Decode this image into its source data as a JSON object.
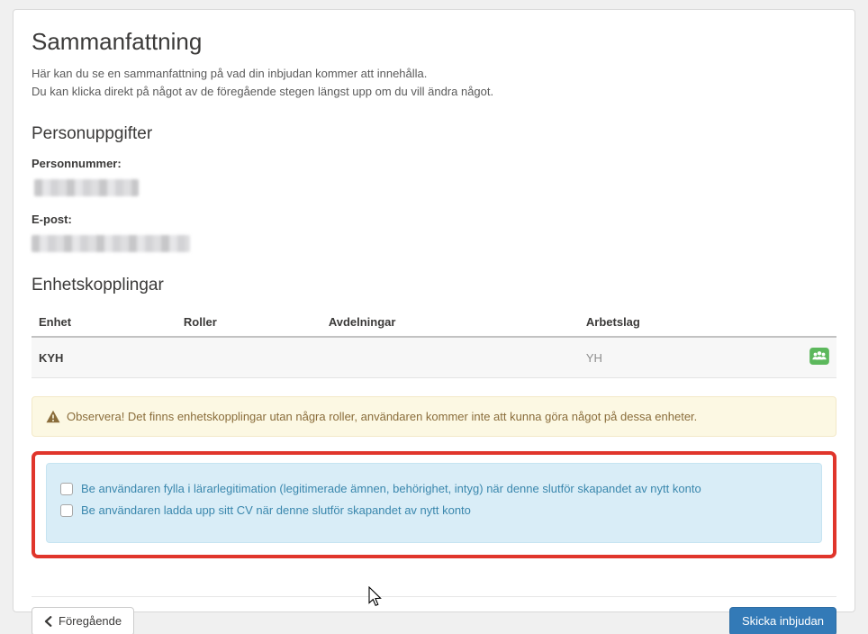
{
  "page": {
    "title": "Sammanfattning",
    "intro_line1": "Här kan du se en sammanfattning på vad din inbjudan kommer att innehålla.",
    "intro_line2": "Du kan klicka direkt på något av de föregående stegen längst upp om du vill ändra något."
  },
  "personal_info": {
    "heading": "Personuppgifter",
    "personnummer_label": "Personnummer:",
    "epost_label": "E-post:"
  },
  "unit_connections": {
    "heading": "Enhetskopplingar",
    "columns": [
      "Enhet",
      "Roller",
      "Avdelningar",
      "Arbetslag"
    ],
    "rows": [
      {
        "enhet": "KYH",
        "roller": "",
        "avdelningar": "",
        "arbetslag": "YH"
      }
    ]
  },
  "warning": {
    "text": "Observera! Det finns enhetskopplingar utan några roller, användaren kommer inte att kunna göra något på dessa enheter."
  },
  "options": {
    "checkbox1": "Be användaren fylla i lärarlegitimation (legitimerade ämnen, behörighet, intyg) när denne slutför skapandet av nytt konto",
    "checkbox2": "Be användaren ladda upp sitt CV när denne slutför skapandet av nytt konto",
    "checkbox1_checked": false,
    "checkbox2_checked": false
  },
  "buttons": {
    "previous": "Föregående",
    "submit": "Skicka inbjudan"
  },
  "icons": {
    "warning": "warning-triangle-icon",
    "row_action": "users-group-icon",
    "previous": "chevron-left-icon",
    "cursor": "mouse-pointer-icon"
  },
  "colors": {
    "page_background": "#f0f0f0",
    "card_background": "#ffffff",
    "primary_button": "#337ab7",
    "warning_background": "#fcf8e3",
    "warning_text": "#8a6d3b",
    "info_background": "#d9edf7",
    "info_text": "#3a87ad",
    "highlight_border": "#e0352b",
    "success_icon": "#5cb85c"
  }
}
